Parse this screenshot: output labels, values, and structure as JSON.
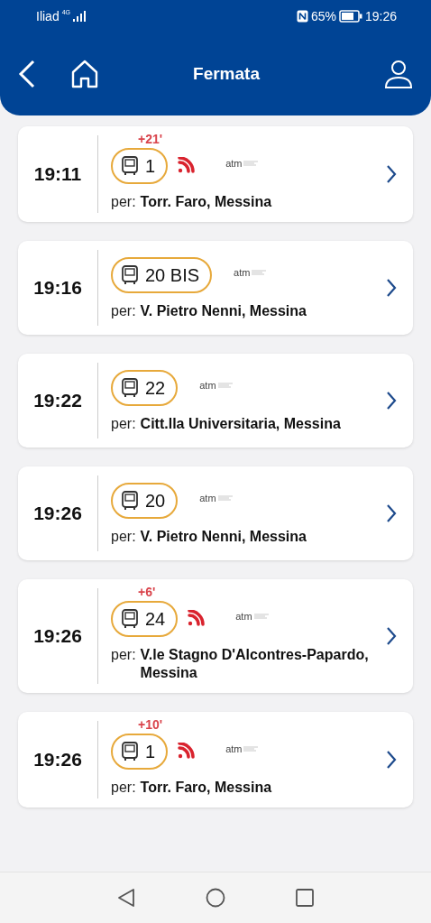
{
  "status_bar": {
    "carrier": "Iliad",
    "network": "4G",
    "battery": "65%",
    "time": "19:26"
  },
  "header": {
    "title": "Fermata"
  },
  "departures": [
    {
      "time": "19:11",
      "delay": "+21'",
      "line": "1",
      "realtime": true,
      "operator": "atm",
      "label": "per:",
      "destination": "Torr. Faro, Messina"
    },
    {
      "time": "19:16",
      "line": "20 BIS",
      "realtime": false,
      "operator": "atm",
      "label": "per:",
      "destination": "V. Pietro Nenni, Messina"
    },
    {
      "time": "19:22",
      "line": "22",
      "realtime": false,
      "operator": "atm",
      "label": "per:",
      "destination": "Citt.lla Universitaria, Messina"
    },
    {
      "time": "19:26",
      "line": "20",
      "realtime": false,
      "operator": "atm",
      "label": "per:",
      "destination": "V. Pietro Nenni, Messina"
    },
    {
      "time": "19:26",
      "delay": "+6'",
      "line": "24",
      "realtime": true,
      "operator": "atm",
      "label": "per:",
      "destination": "V.le Stagno D'Alcontres-Papardo, Messina"
    },
    {
      "time": "19:26",
      "delay": "+10'",
      "line": "1",
      "realtime": true,
      "operator": "atm",
      "label": "per:",
      "destination": "Torr. Faro, Messina"
    }
  ]
}
